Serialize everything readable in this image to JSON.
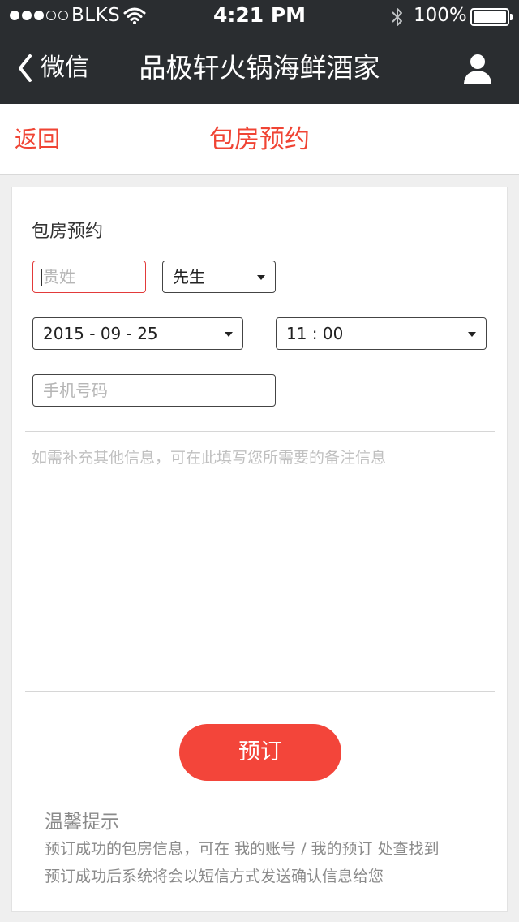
{
  "status_bar": {
    "signal_dots": [
      true,
      true,
      true,
      false,
      false
    ],
    "carrier": "BLKS",
    "time": "4:21 PM",
    "battery_pct": "100%",
    "battery_level": 1.0
  },
  "navbar": {
    "back_label": "微信",
    "title": "品极轩火锅海鲜酒家"
  },
  "page_header": {
    "back_label": "返回",
    "title": "包房预约"
  },
  "form": {
    "section_label": "包房预约",
    "name_placeholder": "贵姓",
    "title_select": "先生",
    "date_select": "2015 - 09 - 25",
    "time_select": "11 : 00",
    "phone_placeholder": "手机号码",
    "notes_placeholder": "如需补充其他信息，可在此填写您所需要的备注信息",
    "submit_label": "预订"
  },
  "tips": {
    "title": "温馨提示",
    "lines": [
      "预订成功的包房信息，可在 我的账号 / 我的预订 处查找到",
      "预订成功后系统将会以短信方式发送确认信息给您"
    ]
  },
  "colors": {
    "accent": "#f3453a",
    "nav_bg": "#2a2d30"
  }
}
